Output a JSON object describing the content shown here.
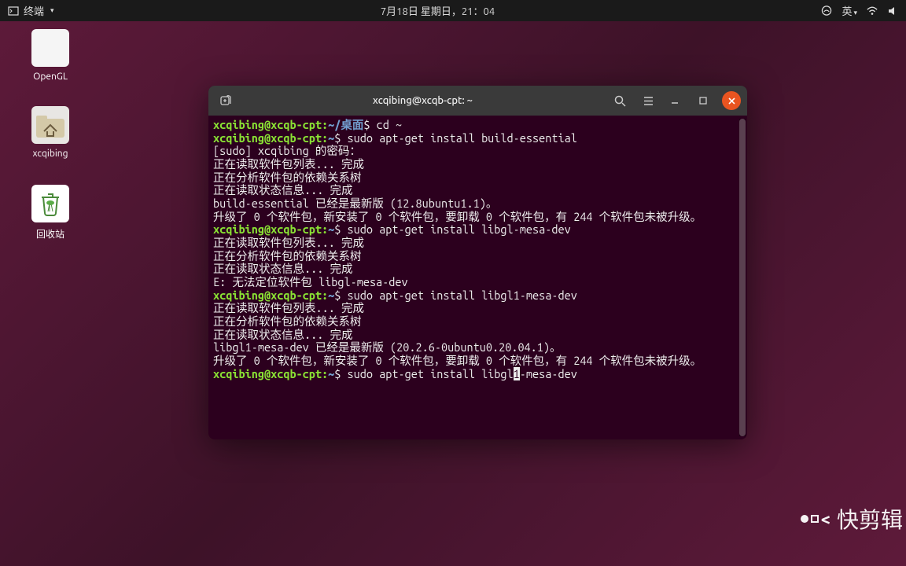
{
  "topbar": {
    "app_name": "终端",
    "datetime": "7月18日 星期日，21：04",
    "ime": "英"
  },
  "desktop": {
    "icons": [
      {
        "label": "OpenGL"
      },
      {
        "label": "xcqibing"
      },
      {
        "label": "回收站"
      }
    ]
  },
  "terminal": {
    "title": "xcqibing@xcqb-cpt: ~",
    "lines": [
      {
        "user": "xcqibing@xcqb-cpt",
        "path": "~/桌面",
        "cmd": "cd ~"
      },
      {
        "user": "xcqibing@xcqb-cpt",
        "path": "~",
        "cmd": "sudo apt-get install build-essential"
      },
      {
        "text": "[sudo] xcqibing 的密码："
      },
      {
        "text": "正在读取软件包列表... 完成"
      },
      {
        "text": "正在分析软件包的依赖关系树"
      },
      {
        "text": "正在读取状态信息... 完成"
      },
      {
        "text": "build-essential 已经是最新版 (12.8ubuntu1.1)。"
      },
      {
        "text": "升级了 0 个软件包，新安装了 0 个软件包，要卸载 0 个软件包，有 244 个软件包未被升级。"
      },
      {
        "user": "xcqibing@xcqb-cpt",
        "path": "~",
        "cmd": "sudo apt-get install libgl-mesa-dev"
      },
      {
        "text": "正在读取软件包列表... 完成"
      },
      {
        "text": "正在分析软件包的依赖关系树"
      },
      {
        "text": "正在读取状态信息... 完成"
      },
      {
        "text": "E: 无法定位软件包 libgl-mesa-dev"
      },
      {
        "user": "xcqibing@xcqb-cpt",
        "path": "~",
        "cmd": "sudo apt-get install libgl1-mesa-dev"
      },
      {
        "text": "正在读取软件包列表... 完成"
      },
      {
        "text": "正在分析软件包的依赖关系树"
      },
      {
        "text": "正在读取状态信息... 完成"
      },
      {
        "text": "libgl1-mesa-dev 已经是最新版 (20.2.6-0ubuntu0.20.04.1)。"
      },
      {
        "text": "升级了 0 个软件包，新安装了 0 个软件包，要卸载 0 个软件包，有 244 个软件包未被升级。"
      },
      {
        "user": "xcqibing@xcqb-cpt",
        "path": "~",
        "cmd_pre": "sudo apt-get install libgl",
        "cmd_cursor": "1",
        "cmd_post": "-mesa-dev",
        "active": true
      }
    ]
  },
  "watermark": {
    "text": "快剪辑"
  }
}
